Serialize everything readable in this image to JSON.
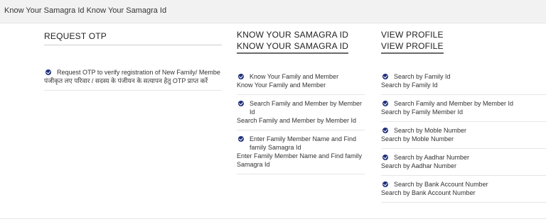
{
  "header": {
    "title": "Know Your Samagra Id Know Your Samagra Id"
  },
  "columns": {
    "request_otp": {
      "heading": "REQUEST OTP",
      "items": [
        {
          "label_en": "Request OTP to verify registration of New Family/ Membe",
          "label_hi": "पंजीकृत लए परिवार / सदस्य के पंजीयन के सत्यापन हेतु OTP प्राप्त करें"
        }
      ]
    },
    "know_samagra": {
      "heading": "KNOW YOUR SAMAGRA ID",
      "heading_repeat": "KNOW YOUR SAMAGRA ID",
      "items": [
        {
          "label": "Know Your Family and Member",
          "sublabel": "Know Your Family and Member"
        },
        {
          "label": "Search Family and Member by Member Id",
          "sublabel": "Search Family and Member by Member Id"
        },
        {
          "label": "Enter Family Member Name and Find family Samagra Id",
          "sublabel": "Enter Family Member Name and Find family Samagra Id"
        }
      ]
    },
    "view_profile": {
      "heading": "VIEW PROFILE",
      "heading_repeat": "VIEW PROFILE",
      "items": [
        {
          "label": "Search by Family Id",
          "sublabel": "Search by Family Id"
        },
        {
          "label": "Search Family and Member by Member Id",
          "sublabel": "Search by Family Member Id"
        },
        {
          "label": "Search by Moble Number",
          "sublabel": "Search by Moble Number"
        },
        {
          "label": "Search by Aadhar Number",
          "sublabel": "Search by Aadhar Number"
        },
        {
          "label": "Search by Bank Account Number",
          "sublabel": "Search by Bank Account Number"
        }
      ]
    }
  },
  "colors": {
    "bullet": "#1f2f7a",
    "topbar_bg": "#f2f2f2",
    "divider": "#e6e6e6"
  },
  "icons": {
    "bullet": "check-circle-icon"
  }
}
